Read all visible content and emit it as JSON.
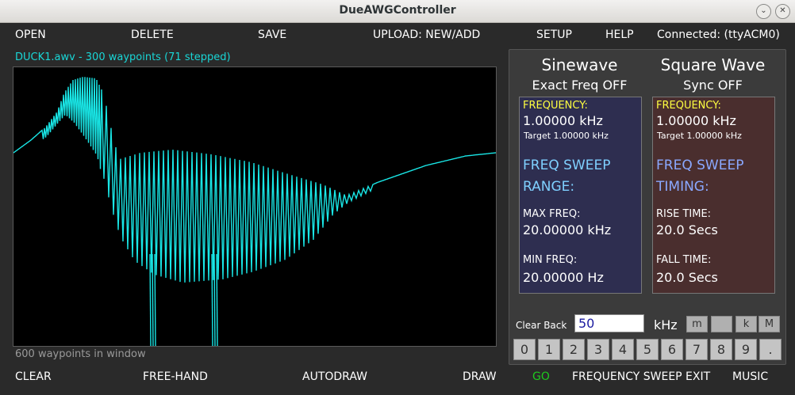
{
  "window": {
    "title": "DueAWGController"
  },
  "menu": {
    "open": "OPEN",
    "delete": "DELETE",
    "save": "SAVE",
    "upload": "UPLOAD: NEW/ADD",
    "setup": "SETUP",
    "help": "HELP",
    "connection": "Connected: (ttyACM0)"
  },
  "canvas": {
    "file_info": "DUCK1.awv - 300 waypoints (71 stepped)",
    "footer": "600 waypoints in window",
    "wave_color": "#19e6e6"
  },
  "bottom": {
    "clear": "CLEAR",
    "freehand": "FREE-HAND",
    "autodraw": "AUTODRAW",
    "draw": "DRAW",
    "go": "GO",
    "sweep_exit": "FREQUENCY SWEEP EXIT",
    "music": "MUSIC"
  },
  "panel": {
    "sine": {
      "title": "Sinewave",
      "subtitle": "Exact Freq OFF",
      "freq_label": "FREQUENCY:",
      "freq_value": "1.00000 kHz",
      "target": "Target  1.00000 kHz",
      "sweep1": "FREQ  SWEEP",
      "sweep2": "RANGE:",
      "max_label": "MAX FREQ:",
      "max_value": "20.00000 kHz",
      "min_label": "MIN FREQ:",
      "min_value": "20.00000 Hz"
    },
    "square": {
      "title": "Square Wave",
      "subtitle": "Sync OFF",
      "freq_label": "FREQUENCY:",
      "freq_value": "1.00000 kHz",
      "target": "Target  1.00000 kHz",
      "sweep1": "FREQ  SWEEP",
      "sweep2": "TIMING:",
      "rise_label": "RISE TIME:",
      "rise_value": "20.0 Secs",
      "fall_label": "FALL TIME:",
      "fall_value": "20.0 Secs"
    },
    "keypad": {
      "clear_back": "Clear Back",
      "input_value": "50",
      "unit": "kHz",
      "multipliers": [
        "m",
        "",
        "k",
        "M"
      ],
      "digits": [
        "0",
        "1",
        "2",
        "3",
        "4",
        "5",
        "6",
        "7",
        "8",
        "9",
        "."
      ]
    }
  }
}
